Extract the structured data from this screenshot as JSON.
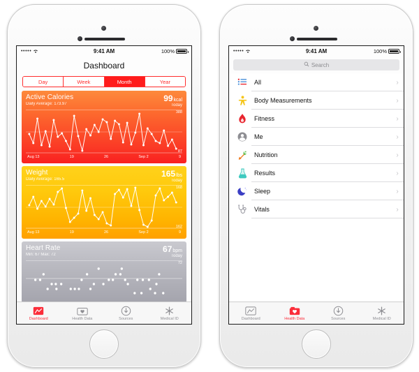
{
  "statusbar": {
    "signal_dots": "•••••",
    "wifi_icon": "wifi-icon",
    "time": "9:41 AM",
    "battery_percent": "100%",
    "battery_icon": "battery-full-icon"
  },
  "left_phone": {
    "nav_title": "Dashboard",
    "segmented": {
      "options": [
        "Day",
        "Week",
        "Month",
        "Year"
      ],
      "selected": "Month",
      "selected_color": "#ff1c1c",
      "tint_color": "#ff2d2d"
    },
    "cards": [
      {
        "name": "active-calories",
        "title": "Active Calories",
        "subtitle": "Daily Average: 173.97",
        "value": "99",
        "unit": "kcal",
        "when": "Today",
        "axis_max": "388",
        "axis_min": "87",
        "xticks": [
          "Aug 13",
          "19",
          "26",
          "Sep 2",
          "9"
        ],
        "accent": "#fb3d26"
      },
      {
        "name": "weight",
        "title": "Weight",
        "subtitle": "Daily Average: 165.5",
        "value": "165",
        "unit": "lbs",
        "when": "Today",
        "axis_max": "168",
        "axis_min": "162",
        "xticks": [
          "Aug 13",
          "19",
          "26",
          "Sep 2",
          "9"
        ],
        "accent": "#ffc90c"
      },
      {
        "name": "heart-rate",
        "title": "Heart Rate",
        "subtitle": "Min: 67  Max: 72",
        "value": "67",
        "unit": "bpm",
        "when": "Today",
        "axis_max": "72",
        "axis_min": "",
        "xticks": [],
        "accent": "#a4a4ad"
      }
    ],
    "tabs": [
      {
        "label": "Dashboard",
        "icon": "dashboard-chart-icon",
        "active": true
      },
      {
        "label": "Health Data",
        "icon": "health-data-heart-icon",
        "active": false
      },
      {
        "label": "Sources",
        "icon": "sources-download-icon",
        "active": false
      },
      {
        "label": "Medical ID",
        "icon": "medical-id-asterisk-icon",
        "active": false
      }
    ]
  },
  "right_phone": {
    "search": {
      "placeholder": "Search",
      "icon": "search-icon",
      "value": ""
    },
    "list_items": [
      {
        "label": "All",
        "icon": "list-lines-icon",
        "color": "#4a90d9"
      },
      {
        "label": "Body Measurements",
        "icon": "person-icon",
        "color": "#f5c518"
      },
      {
        "label": "Fitness",
        "icon": "flame-icon",
        "color": "#e8262f"
      },
      {
        "label": "Me",
        "icon": "head-silhouette-icon",
        "color": "#8e8e93"
      },
      {
        "label": "Nutrition",
        "icon": "carrot-icon",
        "color": "#f07c1e"
      },
      {
        "label": "Results",
        "icon": "flask-icon",
        "color": "#3ec9bf"
      },
      {
        "label": "Sleep",
        "icon": "moon-icon",
        "color": "#3b3fc4"
      },
      {
        "label": "Vitals",
        "icon": "stethoscope-icon",
        "color": "#9a9aa2"
      }
    ],
    "chevron": "›",
    "tabs": [
      {
        "label": "Dashboard",
        "icon": "dashboard-chart-icon",
        "active": false
      },
      {
        "label": "Health Data",
        "icon": "health-data-heart-icon",
        "active": true
      },
      {
        "label": "Sources",
        "icon": "sources-download-icon",
        "active": false
      },
      {
        "label": "Medical ID",
        "icon": "medical-id-asterisk-icon",
        "active": false
      }
    ]
  },
  "chart_data": [
    {
      "type": "line",
      "name": "active-calories",
      "title": "Active Calories",
      "ylabel": "kcal",
      "ylim": [
        87,
        388
      ],
      "x": [
        "Aug 13",
        "19",
        "26",
        "Sep 2",
        "9"
      ],
      "values": [
        150,
        300,
        110,
        250,
        140,
        230,
        135,
        175,
        160,
        120,
        350,
        180,
        90,
        200,
        160,
        260,
        330,
        300,
        150,
        315,
        295,
        140,
        320,
        180,
        130,
        240,
        175,
        370,
        120,
        260,
        230,
        160,
        140,
        210,
        115,
        145,
        100
      ]
    },
    {
      "type": "line",
      "name": "weight",
      "title": "Weight",
      "ylabel": "lbs",
      "ylim": [
        162,
        168
      ],
      "x": [
        "Aug 13",
        "19",
        "26",
        "Sep 2",
        "9"
      ],
      "values": [
        165.2,
        166.0,
        165.0,
        165.6,
        165.1,
        165.8,
        165.3,
        166.8,
        167.1,
        165.0,
        163.3,
        163.7,
        164.1,
        166.9,
        164.8,
        165.9,
        163.9,
        163.5,
        164.0,
        163.2,
        163.0,
        166.2,
        166.6,
        165.9,
        166.9,
        165.2,
        167.2,
        164.5,
        163.0,
        162.9,
        163.4,
        166.0,
        167.0,
        165.6,
        165.9,
        166.2,
        165.7
      ]
    },
    {
      "type": "scatter",
      "name": "heart-rate",
      "title": "Heart Rate",
      "ylabel": "bpm",
      "ylim": [
        67,
        72
      ],
      "points": [
        [
          3,
          69
        ],
        [
          5,
          69
        ],
        [
          8,
          70
        ],
        [
          14,
          70
        ],
        [
          16,
          69
        ],
        [
          20,
          71
        ],
        [
          24,
          72
        ],
        [
          27,
          70
        ],
        [
          30,
          71
        ],
        [
          33,
          69
        ],
        [
          36,
          69
        ],
        [
          40,
          69
        ],
        [
          44,
          69
        ],
        [
          48,
          69
        ],
        [
          52,
          69
        ],
        [
          10,
          68
        ],
        [
          12,
          68
        ],
        [
          15,
          68
        ],
        [
          22,
          68
        ],
        [
          26,
          68
        ],
        [
          29,
          68
        ],
        [
          34,
          68
        ],
        [
          41,
          68
        ],
        [
          50,
          68
        ],
        [
          8,
          67
        ],
        [
          11,
          67
        ],
        [
          18,
          67
        ],
        [
          19,
          67
        ],
        [
          20,
          67
        ],
        [
          24,
          67
        ],
        [
          46,
          67
        ],
        [
          55,
          67
        ],
        [
          58,
          67
        ],
        [
          62,
          67
        ],
        [
          66,
          67
        ]
      ]
    }
  ]
}
